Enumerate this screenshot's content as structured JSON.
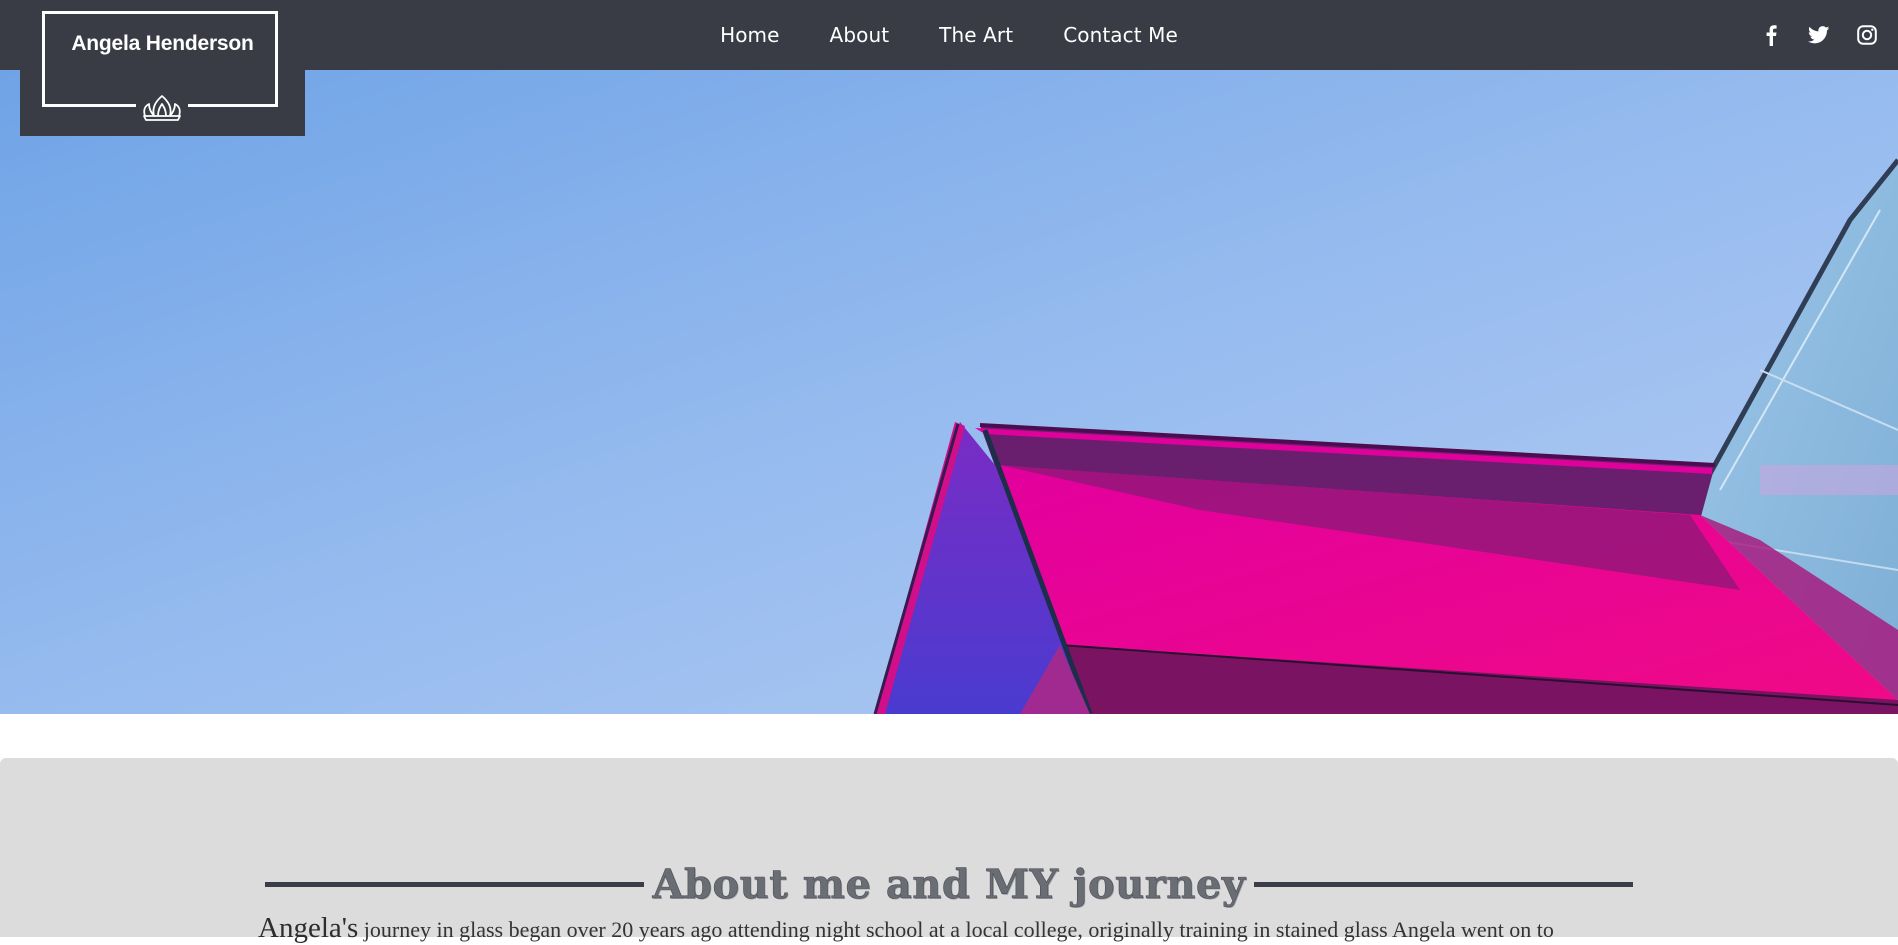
{
  "logo": {
    "title": "Angela Henderson",
    "emblem_icon": "lotus-crown-icon"
  },
  "nav": {
    "items": [
      {
        "label": "Home"
      },
      {
        "label": "About"
      },
      {
        "label": "The Art"
      },
      {
        "label": "Contact Me"
      }
    ]
  },
  "social": {
    "icons": [
      "facebook-icon",
      "twitter-icon",
      "instagram-icon"
    ]
  },
  "hero": {
    "image": "colorful glass building corner against blue sky"
  },
  "about": {
    "heading": "About me and MY journey",
    "lead_word": "Angela's",
    "text": " journey in glass began over 20 years ago attending night school at a local college, originally training in stained glass Angela went on to"
  },
  "colors": {
    "nav_bg": "#393c45",
    "section_bg": "#dcdcdc",
    "heading_line": "#3b3e47",
    "sky_top": "#6fa3e6",
    "sky_bottom": "#a7c3f1",
    "magenta": "#e0009c"
  }
}
